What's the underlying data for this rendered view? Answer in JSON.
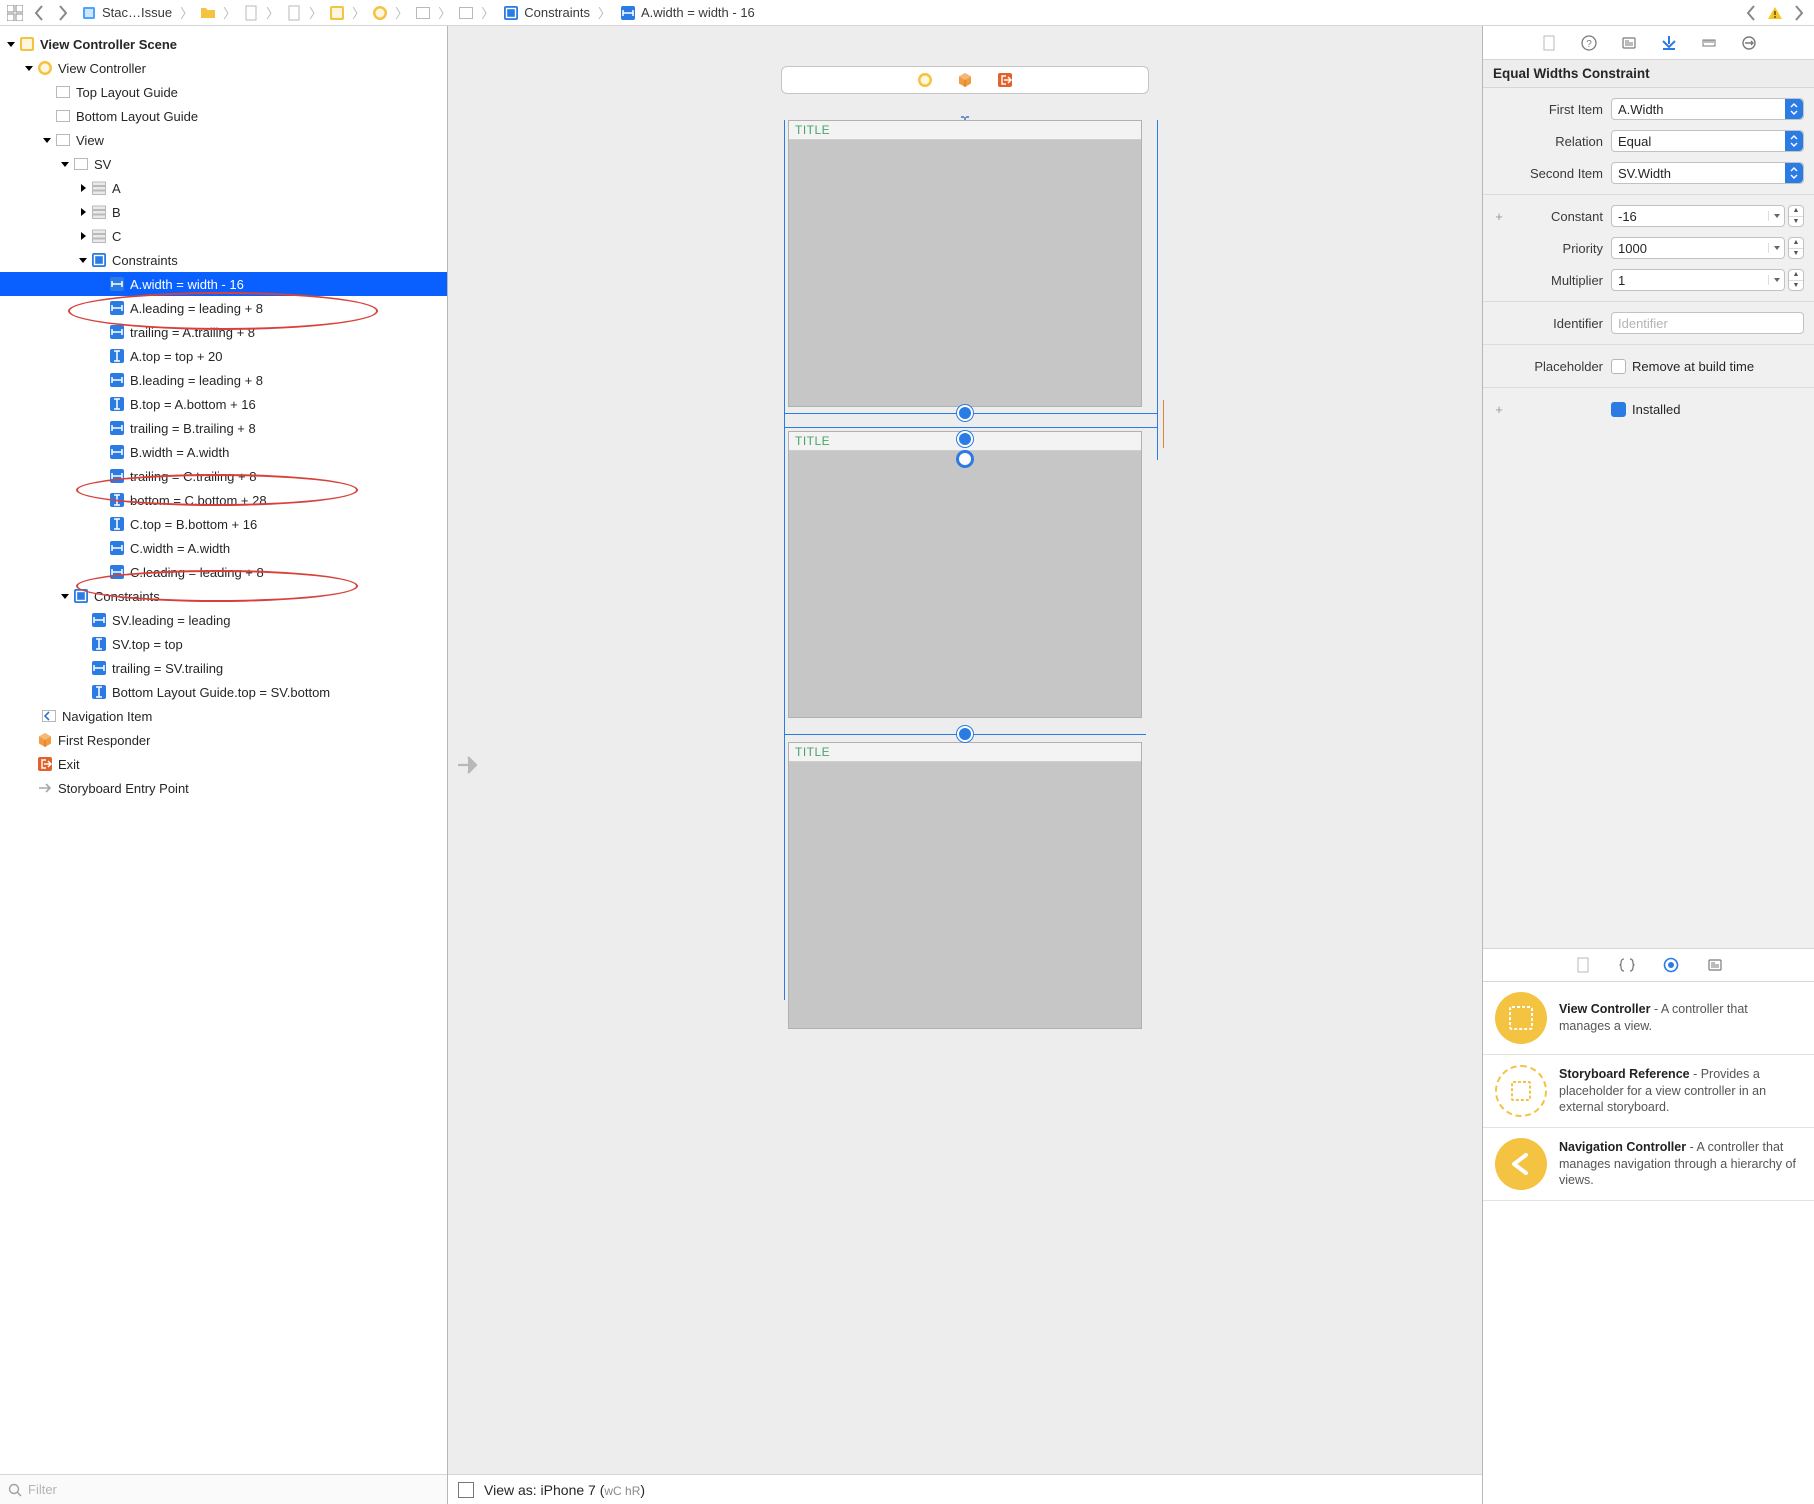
{
  "crumbs": {
    "project": "Stac…Issue",
    "constraints": "Constraints",
    "selected": "A.width = width - 16"
  },
  "outline": {
    "scene": "View Controller Scene",
    "vc": "View Controller",
    "top_guide": "Top Layout Guide",
    "bottom_guide": "Bottom Layout Guide",
    "view": "View",
    "sv": "SV",
    "a": "A",
    "b": "B",
    "c": "C",
    "sv_constraints": "Constraints",
    "c0": "A.width = width - 16",
    "c1": "A.leading = leading + 8",
    "c2": "trailing = A.trailing + 8",
    "c3": "A.top = top + 20",
    "c4": "B.leading = leading + 8",
    "c5": "B.top = A.bottom + 16",
    "c6": "trailing = B.trailing + 8",
    "c7": "B.width = A.width",
    "c8": "trailing = C.trailing + 8",
    "c9": "bottom = C.bottom + 28",
    "c10": "C.top = B.bottom + 16",
    "c11": "C.width = A.width",
    "c12": "C.leading = leading + 8",
    "view_constraints": "Constraints",
    "vc0": "SV.leading = leading",
    "vc1": "SV.top = top",
    "vc2": "trailing = SV.trailing",
    "vc3": "Bottom Layout Guide.top = SV.bottom",
    "nav_item": "Navigation Item",
    "first_responder": "First Responder",
    "exit": "Exit",
    "entry": "Storyboard Entry Point",
    "filter_ph": "Filter"
  },
  "canvas": {
    "title_a": "TITLE",
    "title_b": "TITLE",
    "title_c": "TITLE",
    "viewas_label": "View as: iPhone 7 (",
    "viewas_trait": "wC hR",
    "viewas_close": ")"
  },
  "inspector": {
    "title": "Equal Widths Constraint",
    "lbl_first": "First Item",
    "lbl_relation": "Relation",
    "lbl_second": "Second Item",
    "lbl_constant": "Constant",
    "lbl_priority": "Priority",
    "lbl_multiplier": "Multiplier",
    "lbl_identifier": "Identifier",
    "lbl_placeholder": "Placeholder",
    "lbl_remove": "Remove at build time",
    "lbl_installed": "Installed",
    "val_first": "A.Width",
    "val_relation": "Equal",
    "val_second": "SV.Width",
    "val_constant": "-16",
    "val_priority": "1000",
    "val_multiplier": "1",
    "identifier_ph": "Identifier"
  },
  "library": {
    "i0_t": "View Controller",
    "i0_d": " - A controller that manages a view.",
    "i1_t": "Storyboard Reference",
    "i1_d": " - Provides a placeholder for a view controller in an external storyboard.",
    "i2_t": "Navigation Controller",
    "i2_d": " - A controller that manages navigation through a hierarchy of views."
  }
}
